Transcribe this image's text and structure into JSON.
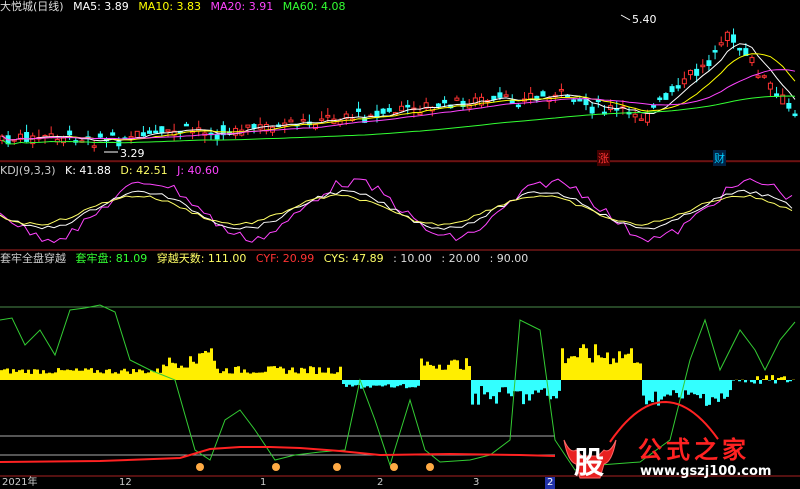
{
  "panel1": {
    "title": "大悦城(日线)",
    "ma": [
      {
        "label": "MA5: 3.89",
        "color": "#ffffff"
      },
      {
        "label": "MA10: 3.83",
        "color": "#ffff00"
      },
      {
        "label": "MA20: 3.91",
        "color": "#ff00ff"
      },
      {
        "label": "MA60: 4.08",
        "color": "#00ff00"
      }
    ],
    "high_label": "5.40",
    "low_label": "3.29",
    "tag_zhang": "涨",
    "tag_cai": "财"
  },
  "panel2": {
    "title": "KDJ(9,3,3)",
    "k": "K: 41.88",
    "d": "D: 42.51",
    "j": "J: 40.60"
  },
  "panel3": {
    "title": "套牢全盘穿越",
    "v1": "套牢盘: 81.09",
    "v2": "穿越天数: 111.00",
    "v3": "CYF: 20.99",
    "v4": "CYS: 47.89",
    "v5": ": 10.00",
    "v6": ": 20.00",
    "v7": ": 90.00"
  },
  "xaxis": {
    "labels": [
      "2021年",
      "12",
      "1",
      "2",
      "3",
      "2"
    ]
  },
  "watermark": {
    "big": "股",
    "text": "公式之家",
    "url": "www.gszj100.com"
  },
  "chart_data": [
    {
      "type": "candlestick",
      "title": "大悦城(日线)",
      "series": [
        {
          "name": "MA5",
          "last": 3.89
        },
        {
          "name": "MA10",
          "last": 3.83
        },
        {
          "name": "MA20",
          "last": 3.91
        },
        {
          "name": "MA60",
          "last": 4.08
        }
      ],
      "annotations": {
        "high": 5.4,
        "low": 3.29
      }
    },
    {
      "type": "line",
      "title": "KDJ(9,3,3)",
      "series": [
        {
          "name": "K",
          "last": 41.88
        },
        {
          "name": "D",
          "last": 42.51
        },
        {
          "name": "J",
          "last": 40.6
        }
      ]
    },
    {
      "type": "bar",
      "title": "套牢全盘穿越",
      "series": [
        {
          "name": "套牢盘",
          "last": 81.09
        },
        {
          "name": "穿越天数",
          "last": 111.0
        },
        {
          "name": "CYF",
          "last": 20.99
        },
        {
          "name": "CYS",
          "last": 47.89
        }
      ],
      "reference_lines": [
        10.0,
        20.0,
        90.0
      ]
    }
  ]
}
